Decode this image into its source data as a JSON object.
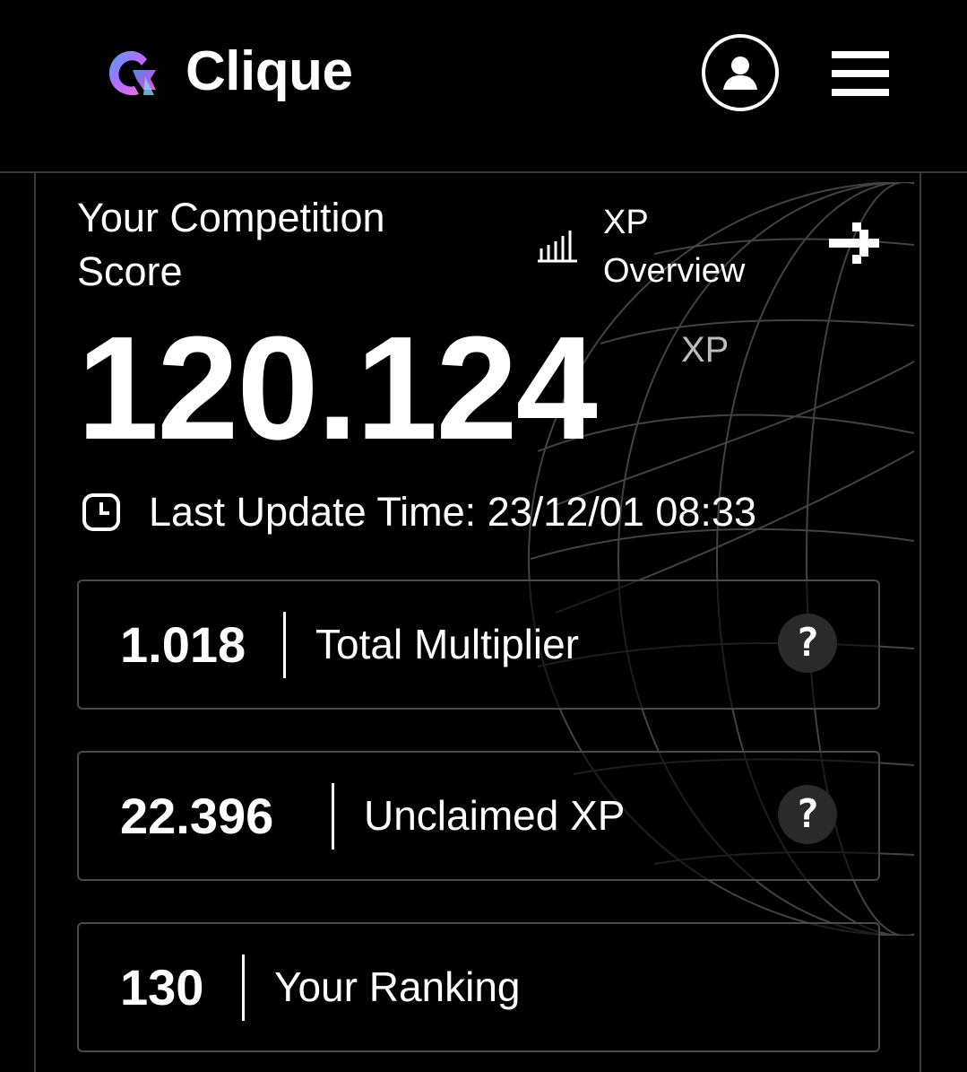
{
  "header": {
    "brand": "Clique",
    "accent_gradient": [
      "#4fa0ff",
      "#b46cff",
      "#ff6fd8"
    ]
  },
  "score": {
    "title": "Your Competition Score",
    "value": "120.124",
    "unit": "XP",
    "last_update": "Last Update Time: 23/12/01 08:33"
  },
  "xp_overview": {
    "label": "XP Overview"
  },
  "stats": [
    {
      "value": "1.018",
      "label": "Total Multiplier",
      "help": "?"
    },
    {
      "value": "22.396",
      "label": "Unclaimed XP",
      "help": "?"
    },
    {
      "value": "130",
      "label": "Your Ranking"
    }
  ],
  "icons": {
    "logo": "clique-logo",
    "profile": "user-icon",
    "menu": "hamburger-menu-icon",
    "bars": "bar-chart-icon",
    "arrow": "arrow-right-icon",
    "clock": "clock-icon",
    "help": "question-icon"
  },
  "colors": {
    "background": "#000000",
    "text": "#ffffff",
    "muted": "#bdbdbd",
    "border": "#4a4a4a",
    "help_bg": "#2a2a2a"
  }
}
